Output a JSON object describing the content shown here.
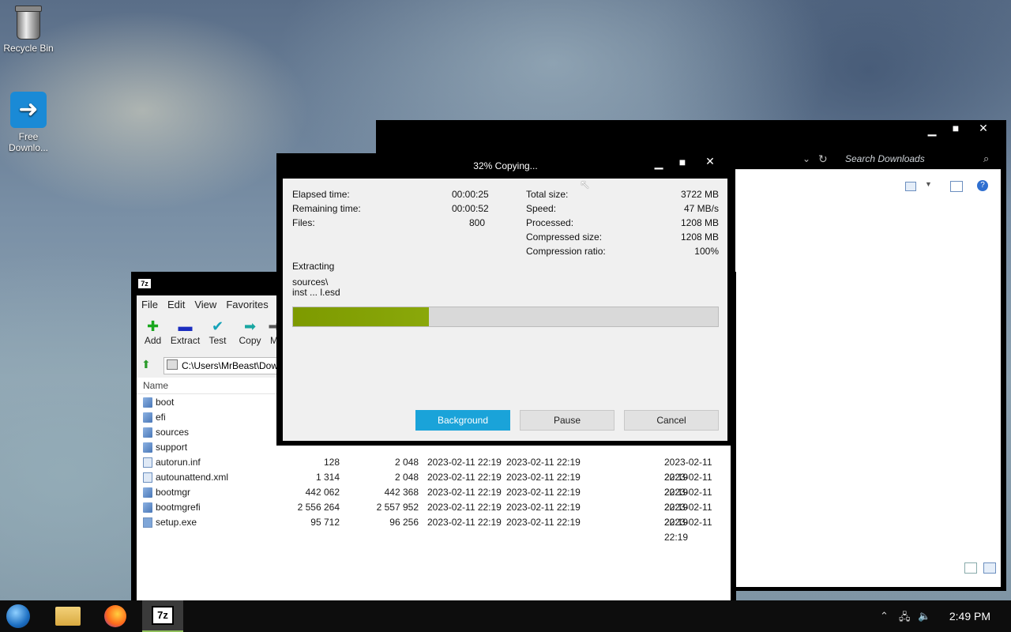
{
  "desktop": {
    "icons": [
      {
        "label": "Recycle Bin"
      },
      {
        "label": "Free Downlo..."
      }
    ]
  },
  "explorer": {
    "search_placeholder": "Search Downloads",
    "controls": {
      "minimize": "▁",
      "maximize": "■",
      "close": "✕"
    }
  },
  "sevenzip": {
    "title_icon": "7z",
    "menu": [
      "File",
      "Edit",
      "View",
      "Favorites"
    ],
    "toolbar": [
      {
        "label": "Add",
        "icon": "plus-icon",
        "glyph": "✚",
        "color": "#19a71d"
      },
      {
        "label": "Extract",
        "icon": "minus-icon",
        "glyph": "▬",
        "color": "#1b2dbf"
      },
      {
        "label": "Test",
        "icon": "check-icon",
        "glyph": "✔",
        "color": "#16a3b8"
      },
      {
        "label": "Copy",
        "icon": "arrow-right-icon",
        "glyph": "➡",
        "color": "#18a6a1"
      },
      {
        "label": "M",
        "icon": "move-icon",
        "glyph": "➡",
        "color": "#555"
      }
    ],
    "address": "C:\\Users\\MrBeast\\Down",
    "column_name": "Name",
    "rows": [
      {
        "name": "boot",
        "type": "folder",
        "size": "",
        "packed": "",
        "modified": "",
        "created": "",
        "accessed": ""
      },
      {
        "name": "efi",
        "type": "folder",
        "size": "",
        "packed": "",
        "modified": "",
        "created": "",
        "accessed": ""
      },
      {
        "name": "sources",
        "type": "folder",
        "size": "",
        "packed": "",
        "modified": "",
        "created": "",
        "accessed": ""
      },
      {
        "name": "support",
        "type": "folder",
        "size": "",
        "packed": "",
        "modified": "",
        "created": "",
        "accessed": ""
      },
      {
        "name": "autorun.inf",
        "type": "file",
        "size": "128",
        "packed": "2 048",
        "modified": "2023-02-11 22:19",
        "created": "2023-02-11 22:19",
        "accessed": "2023-02-11 22:19"
      },
      {
        "name": "autounattend.xml",
        "type": "file",
        "size": "1 314",
        "packed": "2 048",
        "modified": "2023-02-11 22:19",
        "created": "2023-02-11 22:19",
        "accessed": "2023-02-11 22:19"
      },
      {
        "name": "bootmgr",
        "type": "file",
        "size": "442 062",
        "packed": "442 368",
        "modified": "2023-02-11 22:19",
        "created": "2023-02-11 22:19",
        "accessed": "2023-02-11 22:19"
      },
      {
        "name": "bootmgrefi",
        "type": "file",
        "size": "2 556 264",
        "packed": "2 557 952",
        "modified": "2023-02-11 22:19",
        "created": "2023-02-11 22:19",
        "accessed": "2023-02-11 22:19"
      },
      {
        "name": "setup.exe",
        "type": "exe",
        "size": "95 712",
        "packed": "96 256",
        "modified": "2023-02-11 22:19",
        "created": "2023-02-11 22:19",
        "accessed": "2023-02-11 22:19"
      }
    ]
  },
  "progress": {
    "title": "32% Copying...",
    "percent": 32,
    "elapsed_label": "Elapsed time:",
    "elapsed_value": "00:00:25",
    "remaining_label": "Remaining time:",
    "remaining_value": "00:00:52",
    "files_label": "Files:",
    "files_value": "800",
    "total_label": "Total size:",
    "total_value": "3722 MB",
    "speed_label": "Speed:",
    "speed_value": "47 MB/s",
    "processed_label": "Processed:",
    "processed_value": "1208 MB",
    "compressed_label": "Compressed size:",
    "compressed_value": "1208 MB",
    "ratio_label": "Compression ratio:",
    "ratio_value": "100%",
    "operation": "Extracting",
    "path_line1": "sources\\",
    "path_line2": "inst ... l.esd",
    "buttons": {
      "background": "Background",
      "pause": "Pause",
      "cancel": "Cancel"
    },
    "accent_color": "#1aa3d9",
    "bar_color": "#7d9a00"
  },
  "taskbar": {
    "clock": "2:49 PM",
    "active_app": "7z"
  }
}
